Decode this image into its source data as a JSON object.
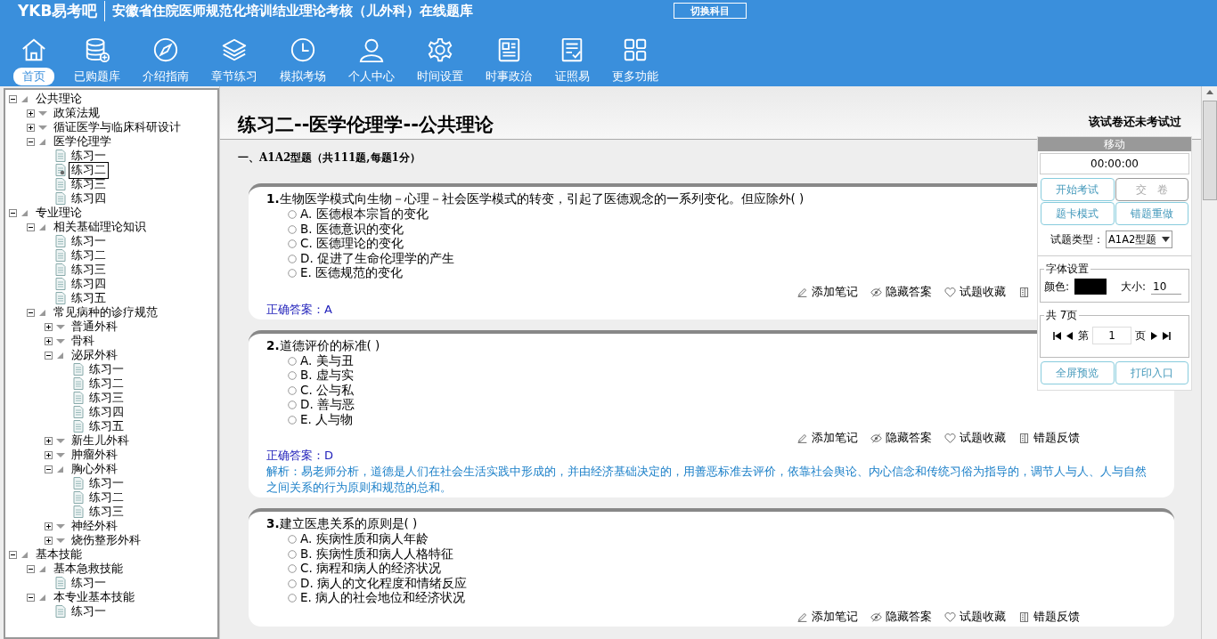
{
  "header": {
    "logo": "YKB易考吧",
    "title": "安徽省住院医师规范化培训结业理论考核（儿外科）在线题库",
    "switch_button": "切换科目"
  },
  "nav": [
    {
      "label": "首页",
      "kind": "home",
      "selected": true
    },
    {
      "label": "已购题库",
      "kind": "database",
      "selected": false
    },
    {
      "label": "介绍指南",
      "kind": "compass",
      "selected": false
    },
    {
      "label": "章节练习",
      "kind": "layers",
      "selected": false
    },
    {
      "label": "模拟考场",
      "kind": "clock",
      "selected": false
    },
    {
      "label": "个人中心",
      "kind": "user",
      "selected": false
    },
    {
      "label": "时间设置",
      "kind": "gear",
      "selected": false
    },
    {
      "label": "时事政治",
      "kind": "news",
      "selected": false
    },
    {
      "label": "证照易",
      "kind": "checklist",
      "selected": false
    },
    {
      "label": "更多功能",
      "kind": "grid",
      "selected": false
    }
  ],
  "tree": [
    {
      "label": "公共理论",
      "kind": "folder",
      "expanded": true,
      "selected": false,
      "children": [
        {
          "label": "政策法规",
          "kind": "folder",
          "expanded": false,
          "selected": false
        },
        {
          "label": "循证医学与临床科研设计",
          "kind": "folder",
          "expanded": false,
          "selected": false
        },
        {
          "label": "医学伦理学",
          "kind": "folder",
          "expanded": true,
          "selected": false,
          "children": [
            {
              "label": "练习一",
              "kind": "leaf",
              "selected": false
            },
            {
              "label": "练习二",
              "kind": "leaf",
              "selected": true
            },
            {
              "label": "练习三",
              "kind": "leaf",
              "selected": false
            },
            {
              "label": "练习四",
              "kind": "leaf",
              "selected": false
            }
          ]
        }
      ]
    },
    {
      "label": "专业理论",
      "kind": "folder",
      "expanded": true,
      "selected": false,
      "children": [
        {
          "label": "相关基础理论知识",
          "kind": "folder",
          "expanded": true,
          "selected": false,
          "children": [
            {
              "label": "练习一",
              "kind": "leaf",
              "selected": false
            },
            {
              "label": "练习二",
              "kind": "leaf",
              "selected": false
            },
            {
              "label": "练习三",
              "kind": "leaf",
              "selected": false
            },
            {
              "label": "练习四",
              "kind": "leaf",
              "selected": false
            },
            {
              "label": "练习五",
              "kind": "leaf",
              "selected": false
            }
          ]
        },
        {
          "label": "常见病种的诊疗规范",
          "kind": "folder",
          "expanded": true,
          "selected": false,
          "children": [
            {
              "label": "普通外科",
              "kind": "folder",
              "expanded": false,
              "selected": false
            },
            {
              "label": "骨科",
              "kind": "folder",
              "expanded": false,
              "selected": false
            },
            {
              "label": "泌尿外科",
              "kind": "folder",
              "expanded": true,
              "selected": false,
              "children": [
                {
                  "label": "练习一",
                  "kind": "leaf",
                  "selected": false
                },
                {
                  "label": "练习二",
                  "kind": "leaf",
                  "selected": false
                },
                {
                  "label": "练习三",
                  "kind": "leaf",
                  "selected": false
                },
                {
                  "label": "练习四",
                  "kind": "leaf",
                  "selected": false
                },
                {
                  "label": "练习五",
                  "kind": "leaf",
                  "selected": false
                }
              ]
            },
            {
              "label": "新生儿外科",
              "kind": "folder",
              "expanded": false,
              "selected": false
            },
            {
              "label": "肿瘤外科",
              "kind": "folder",
              "expanded": false,
              "selected": false
            },
            {
              "label": "胸心外科",
              "kind": "folder",
              "expanded": true,
              "selected": false,
              "children": [
                {
                  "label": "练习一",
                  "kind": "leaf",
                  "selected": false
                },
                {
                  "label": "练习二",
                  "kind": "leaf",
                  "selected": false
                },
                {
                  "label": "练习三",
                  "kind": "leaf",
                  "selected": false
                }
              ]
            },
            {
              "label": "神经外科",
              "kind": "folder",
              "expanded": false,
              "selected": false
            },
            {
              "label": "烧伤整形外科",
              "kind": "folder",
              "expanded": false,
              "selected": false
            }
          ]
        }
      ]
    },
    {
      "label": "基本技能",
      "kind": "folder",
      "expanded": true,
      "selected": false,
      "children": [
        {
          "label": "基本急救技能",
          "kind": "folder",
          "expanded": true,
          "selected": false,
          "children": [
            {
              "label": "练习一",
              "kind": "leaf",
              "selected": false
            }
          ]
        },
        {
          "label": "本专业基本技能",
          "kind": "folder",
          "expanded": true,
          "selected": false,
          "children": [
            {
              "label": "练习一",
              "kind": "leaf",
              "selected": false
            }
          ]
        }
      ]
    }
  ],
  "paper": {
    "title": "练习二--医学伦理学--公共理论",
    "status": "该试卷还未考试过",
    "section": "一、A1A2型题（共111题,每题1分）"
  },
  "questions": [
    {
      "number": "1.",
      "text": "生物医学模式向生物－心理－社会医学模式的转变，引起了医德观念的一系列变化。但应除外( )",
      "options": [
        {
          "text": "A. 医德根本宗旨的变化",
          "checked": false
        },
        {
          "text": "B. 医德意识的变化",
          "checked": false
        },
        {
          "text": "C. 医德理论的变化",
          "checked": false
        },
        {
          "text": "D. 促进了生命伦理学的产生",
          "checked": false
        },
        {
          "text": "E. 医德规范的变化",
          "checked": false
        }
      ],
      "actions": [
        {
          "label": "添加笔记",
          "kind": "pencil"
        },
        {
          "label": "隐藏答案",
          "kind": "eye"
        },
        {
          "label": "试题收藏",
          "kind": "heart"
        },
        {
          "kind": "form"
        }
      ],
      "answer": "正确答案：A"
    },
    {
      "number": "2.",
      "text": "道德评价的标准( )",
      "options": [
        {
          "text": "A. 美与丑",
          "checked": false
        },
        {
          "text": "B. 虚与实",
          "checked": false
        },
        {
          "text": "C. 公与私",
          "checked": false
        },
        {
          "text": "D. 善与恶",
          "checked": false
        },
        {
          "text": "E. 人与物",
          "checked": false
        }
      ],
      "actions": [
        {
          "label": "添加笔记",
          "kind": "pencil"
        },
        {
          "label": "隐藏答案",
          "kind": "eye"
        },
        {
          "label": "试题收藏",
          "kind": "heart"
        },
        {
          "label": "错题反馈",
          "kind": "form"
        }
      ],
      "answer": "正确答案：D",
      "analysis": "解析：易老师分析，道德是人们在社会生活实践中形成的，并由经济基础决定的，用善恶标准去评价，依靠社会舆论、内心信念和传统习俗为指导的，调节人与人、人与自然之间关系的行为原则和规范的总和。"
    },
    {
      "number": "3.",
      "text": "建立医患关系的原则是( )",
      "options": [
        {
          "text": "A. 疾病性质和病人年龄",
          "checked": false
        },
        {
          "text": "B. 疾病性质和病人人格特征",
          "checked": false
        },
        {
          "text": "C. 病程和病人的经济状况",
          "checked": false
        },
        {
          "text": "D. 病人的文化程度和情绪反应",
          "checked": false
        },
        {
          "text": "E. 病人的社会地位和经济状况",
          "checked": false
        }
      ],
      "actions": [
        {
          "label": "添加笔记",
          "kind": "pencil"
        },
        {
          "label": "隐藏答案",
          "kind": "eye"
        },
        {
          "label": "试题收藏",
          "kind": "heart"
        },
        {
          "label": "错题反馈",
          "kind": "form"
        }
      ]
    }
  ],
  "panel": {
    "handle": "移动",
    "timer": "00:00:00",
    "buttons": [
      {
        "label": "开始考试",
        "disabled": false
      },
      {
        "label": "交　卷",
        "disabled": true
      },
      {
        "label": "题卡模式",
        "disabled": false
      },
      {
        "label": "错题重做",
        "disabled": false
      }
    ],
    "type_label": "试题类型：",
    "type_value": "A1A2型题",
    "font_legend": "字体设置",
    "color_label": "颜色:",
    "color": "#000000",
    "size_label": "大小:",
    "size_value": "10",
    "pager_legend": "共 7页",
    "page_prefix": "第",
    "page_value": "1",
    "page_suffix": "页",
    "bottom_buttons": [
      "全屏预览",
      "打印入口"
    ]
  }
}
